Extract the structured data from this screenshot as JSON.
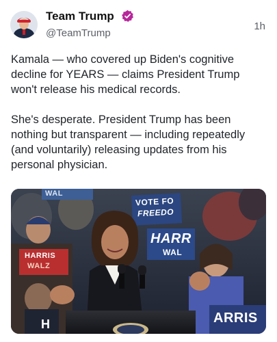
{
  "post": {
    "author_name": "Team Trump",
    "author_handle": "@TeamTrump",
    "timestamp": "1h",
    "verified_icon": "verified-badge-icon",
    "verified_color": "#b7279b",
    "paragraphs": [
      "Kamala — who covered up Biden's cognitive decline for YEARS — claims President Trump won't release his medical records.",
      "She's desperate. President Trump has been nothing but transparent — including repeatedly (and voluntarily) releasing updates from his personal physician."
    ]
  },
  "media": {
    "signs": {
      "wal": "WAL",
      "vote_for": "VOTE FO",
      "freedom": "FREEDO",
      "harris_walz_big": "HARR",
      "walz_big": "WAL",
      "harris_small": "HARRIS",
      "walz_small": "WALZ",
      "arris": "ARRIS",
      "h_letter": "H"
    }
  }
}
